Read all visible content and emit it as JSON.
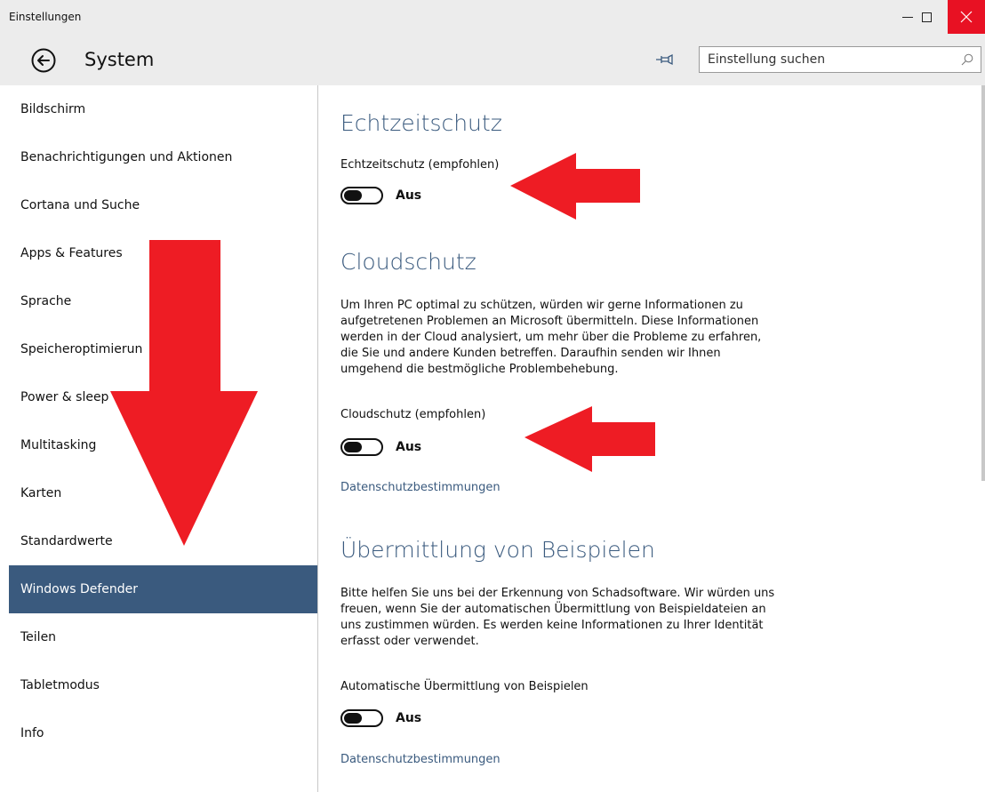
{
  "window": {
    "title": "Einstellungen"
  },
  "header": {
    "title": "System",
    "search_placeholder": "Einstellung suchen"
  },
  "sidebar": {
    "items": [
      {
        "label": "Bildschirm"
      },
      {
        "label": "Benachrichtigungen und Aktionen"
      },
      {
        "label": "Cortana und Suche"
      },
      {
        "label": "Apps & Features"
      },
      {
        "label": "Sprache"
      },
      {
        "label": "Speicheroptimierun"
      },
      {
        "label": "Power & sleep"
      },
      {
        "label": "Multitasking"
      },
      {
        "label": "Karten"
      },
      {
        "label": "Standardwerte"
      },
      {
        "label": "Windows Defender"
      },
      {
        "label": "Teilen"
      },
      {
        "label": "Tabletmodus"
      },
      {
        "label": "Info"
      }
    ],
    "active_index": 10
  },
  "content": {
    "realtime": {
      "title": "Echtzeitschutz",
      "toggle_label": "Echtzeitschutz (empfohlen)",
      "toggle_state": "Aus"
    },
    "cloud": {
      "title": "Cloudschutz",
      "description": "Um Ihren PC optimal zu schützen, würden wir gerne Informationen zu aufgetretenen Problemen an Microsoft übermitteln. Diese Informationen werden in der Cloud analysiert, um mehr über die Probleme zu erfahren, die Sie und andere Kunden betreffen. Daraufhin senden wir Ihnen umgehend die bestmögliche Problembehebung.",
      "toggle_label": "Cloudschutz (empfohlen)",
      "toggle_state": "Aus",
      "link": "Datenschutzbestimmungen"
    },
    "samples": {
      "title": "Übermittlung von Beispielen",
      "description": "Bitte helfen Sie uns bei der Erkennung von Schadsoftware. Wir würden uns freuen, wenn Sie der automatischen Übermittlung von Beispieldateien an uns zustimmen würden. Es werden keine Informationen zu Ihrer Identität erfasst oder verwendet.",
      "toggle_label": "Automatische Übermittlung von Beispielen",
      "toggle_state": "Aus",
      "link": "Datenschutzbestimmungen"
    }
  },
  "colors": {
    "accent": "#3a5a7e",
    "close": "#e81123",
    "annotation": "#ee1c24"
  },
  "icons": {
    "back": "back-arrow-circle-icon",
    "pin": "pin-icon",
    "search": "search-icon",
    "minimize": "minimize-icon",
    "maximize": "maximize-icon",
    "close": "close-icon"
  }
}
